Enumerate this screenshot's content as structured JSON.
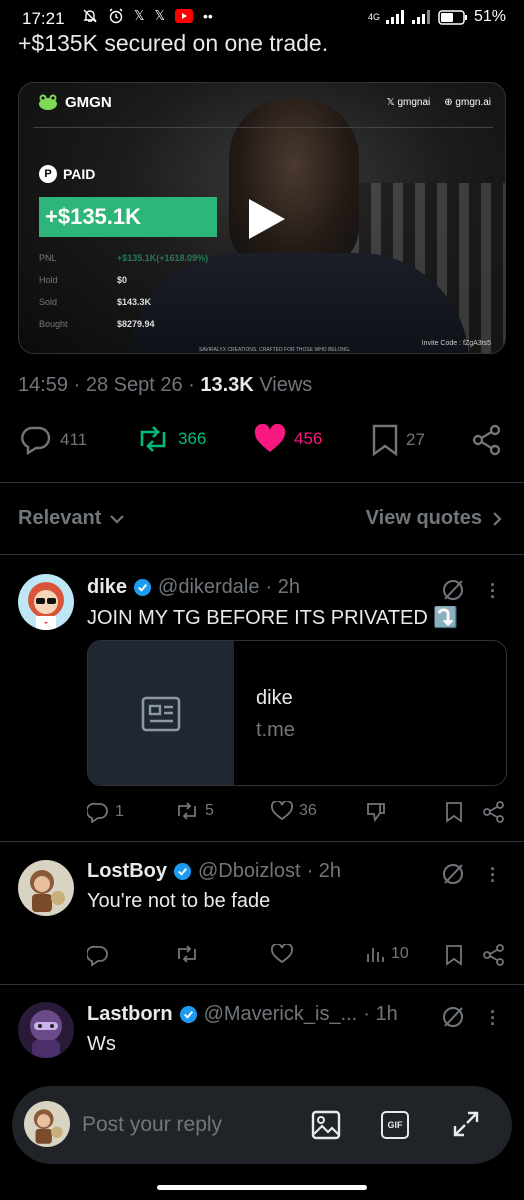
{
  "status_bar": {
    "time": "17:21",
    "network": "4G",
    "battery": "51%"
  },
  "tweet": {
    "text": "+$135K secured on one trade.",
    "time": "14:59",
    "date": "28 Sept 26",
    "views_count": "13.3K",
    "views_label": "Views",
    "replies": "411",
    "reposts": "366",
    "likes": "456",
    "bookmarks": "27"
  },
  "media": {
    "brand": "GMGN",
    "x_handle": "gmgnai",
    "site": "gmgn.ai",
    "badge": "PAID",
    "pnl_amount": "+$135.1K",
    "stats": [
      {
        "label": "PNL",
        "value": "+$135.1K(+1618.09%)"
      },
      {
        "label": "Hold",
        "value": "$0"
      },
      {
        "label": "Sold",
        "value": "$143.3K"
      },
      {
        "label": "Bought",
        "value": "$8279.94"
      }
    ],
    "caption": "SAVIRALYX CREATIONS. CRAFTED FOR THOSE WHO BELONG.",
    "invite": "Invite Code : fZgA3ts5"
  },
  "filters": {
    "sort": "Relevant",
    "quotes": "View quotes"
  },
  "replies": [
    {
      "name": "dike",
      "handle": "@dikerdale",
      "age": "· 2h",
      "text": "JOIN MY TG BEFORE ITS PRIVATED ⤵️",
      "card_title": "dike",
      "card_domain": "t.me",
      "reply_count": "1",
      "repost_count": "5",
      "like_count": "36"
    },
    {
      "name": "LostBoy",
      "handle": "@Dboizlost",
      "age": "· 2h",
      "text": "You're not to be fade",
      "views_count": "10"
    },
    {
      "name": "Lastborn",
      "handle": "@Maverick_is_...",
      "age": "· 1h",
      "text": "Ws"
    }
  ],
  "composer": {
    "placeholder": "Post your reply",
    "gif_label": "GIF"
  },
  "colors": {
    "background": "#000000",
    "muted": "#71767b",
    "text": "#e7e9ea",
    "repost_green": "#00ba7c",
    "like_pink": "#f91880",
    "verified_blue": "#1d9bf0",
    "pnl_green": "#2db57a"
  }
}
